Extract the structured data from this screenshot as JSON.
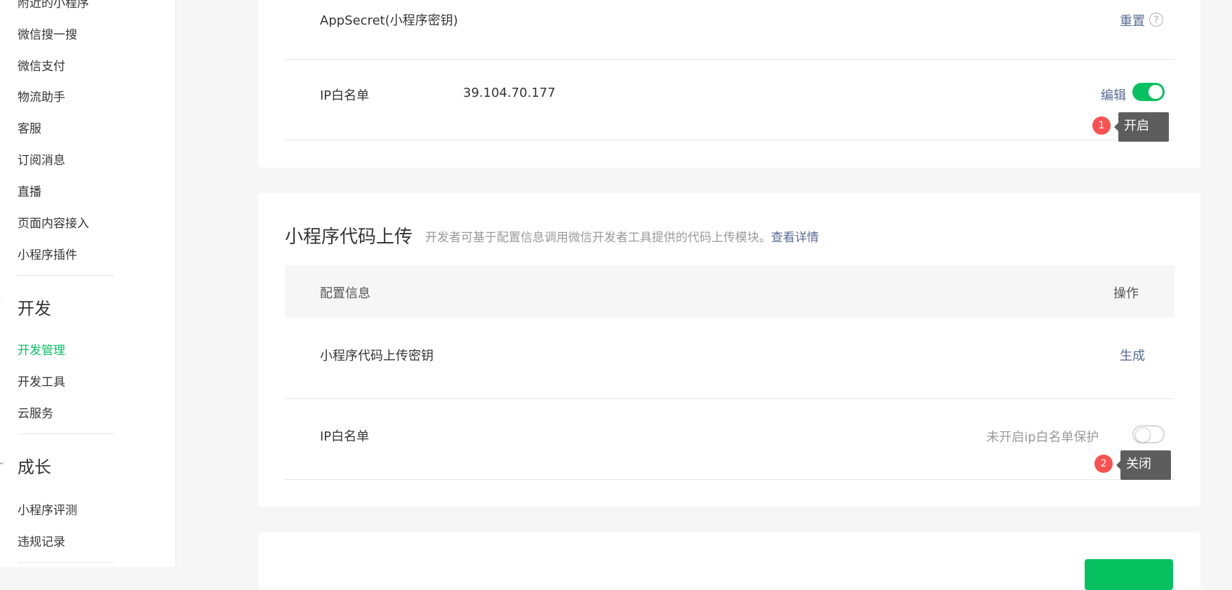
{
  "sidebar": {
    "items": [
      {
        "label": "附近的小程序"
      },
      {
        "label": "微信搜一搜"
      },
      {
        "label": "微信支付"
      },
      {
        "label": "物流助手"
      },
      {
        "label": "客服"
      },
      {
        "label": "订阅消息"
      },
      {
        "label": "直播"
      },
      {
        "label": "页面内容接入"
      },
      {
        "label": "小程序插件"
      }
    ],
    "section_dev": {
      "title": "开发",
      "items": [
        {
          "label": "开发管理"
        },
        {
          "label": "开发工具"
        },
        {
          "label": "云服务"
        }
      ]
    },
    "section_growth": {
      "title": "成长",
      "items": [
        {
          "label": "小程序评测"
        },
        {
          "label": "违规记录"
        }
      ]
    }
  },
  "card1": {
    "appsecret_label": "AppSecret(小程序密钥)",
    "appsecret_action": "重置",
    "help_glyph": "?",
    "ip_label": "IP白名单",
    "ip_value": "39.104.70.177",
    "ip_action": "编辑",
    "toggle_state": "on",
    "tooltip_badge": "1",
    "tooltip_text": "开启"
  },
  "card2": {
    "title": "小程序代码上传",
    "description": "开发者可基于配置信息调用微信开发者工具提供的代码上传模块。",
    "detail_link": "查看详情",
    "col_config": "配置信息",
    "col_action": "操作",
    "key_label": "小程序代码上传密钥",
    "key_action": "生成",
    "ip_label": "IP白名单",
    "ip_status": "未开启ip白名单保护",
    "toggle_state": "off",
    "tooltip_badge": "2",
    "tooltip_text": "关闭"
  },
  "colors": {
    "accent": "#07c160",
    "link": "#576b95",
    "badge": "#fa5151",
    "tooltip": "#5d5d5d"
  }
}
